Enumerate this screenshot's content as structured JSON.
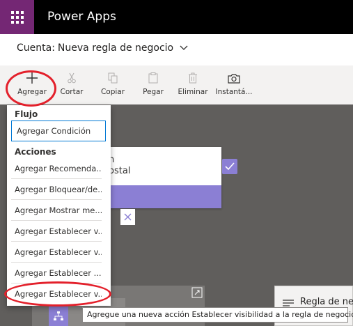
{
  "app": {
    "title": "Power Apps"
  },
  "breadcrumb": {
    "entity": "Cuenta:",
    "rule": "Nueva regla de negocio"
  },
  "toolbar": {
    "add": "Agregar",
    "cut": "Cortar",
    "copy": "Copiar",
    "paste": "Pegar",
    "delete": "Eliminar",
    "snapshot": "Instantá..."
  },
  "canvas": {
    "card_line1": "n",
    "card_line2": "ostal"
  },
  "menu": {
    "section_flow": "Flujo",
    "add_condition": "Agregar Condición",
    "section_actions": "Acciones",
    "items": [
      "Agregar Recomenda...",
      "Agregar Bloquear/de...",
      "Agregar Mostrar me...",
      "Agregar Establecer v...",
      "Agregar Establecer v...",
      "Agregar Establecer ...",
      "Agregar Establecer v..."
    ]
  },
  "tooltip": "Agregue una nueva acción Establecer visibilidad a la regla de negocio.",
  "rule_panel": {
    "label": "Regla de ne"
  },
  "colors": {
    "brand": "#742774",
    "accent": "#8b7fd4",
    "annotation": "#e3202b"
  }
}
